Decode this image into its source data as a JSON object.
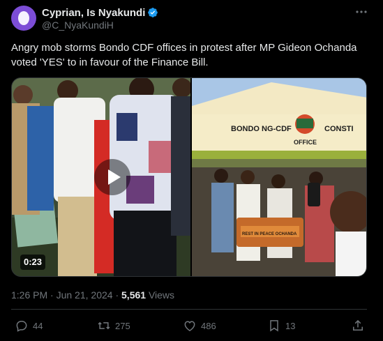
{
  "author": {
    "display_name": "Cyprian, Is Nyakundi",
    "handle": "@C_NyaKundiH"
  },
  "tweet": {
    "text": "Angry mob storms Bondo CDF offices in protest after MP Gideon Ochanda voted 'YES' to in favour of the Finance Bill."
  },
  "media": {
    "duration": "0:23",
    "signage": {
      "office_name": "BONDO NG-CDF",
      "office_label": "OFFICE",
      "office_suffix": "CONSTI",
      "coffin_text": "REST IN PEACE OCHANDA"
    }
  },
  "meta": {
    "time": "1:26 PM",
    "separator": "·",
    "date": "Jun 21, 2024",
    "views_count": "5,561",
    "views_label": "Views"
  },
  "actions": {
    "replies": "44",
    "reposts": "275",
    "likes": "486",
    "bookmarks": "13"
  },
  "colors": {
    "background": "#000000",
    "text": "#e7e9ea",
    "muted": "#71767b",
    "verified": "#1d9bf0",
    "avatar": "#7c4dd6"
  },
  "icons": [
    "verified-badge-icon",
    "more-icon",
    "play-icon",
    "reply-icon",
    "repost-icon",
    "like-icon",
    "bookmark-icon",
    "share-icon"
  ]
}
